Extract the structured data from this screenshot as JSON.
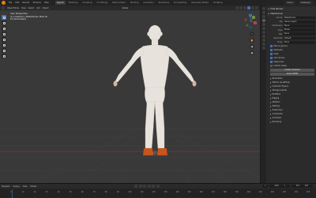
{
  "window": {
    "title": "Blender"
  },
  "topbar": {
    "menus": [
      "File",
      "Edit",
      "Render",
      "Window",
      "Help"
    ],
    "workspaces": [
      "Layout",
      "Modeling",
      "Sculpting",
      "UV Editing",
      "Texture Paint",
      "Shading",
      "Animation",
      "Rendering",
      "Compositing",
      "Geometry Nodes",
      "Scripting"
    ],
    "active_workspace": "Layout",
    "scene_label": "Scene",
    "view_layer_label": "ViewLayer"
  },
  "viewport_header": {
    "mode": "Object Mode",
    "menus": [
      "View",
      "Select",
      "Add",
      "Object"
    ],
    "transform": "Global"
  },
  "viewport_overlay": {
    "line1": "User Perspective",
    "line2": "(1) Collection | MakeHuman Male 3k",
    "line3": "10 Centimeters"
  },
  "gizmo": {
    "x_label": "X",
    "y_label": "Y",
    "z_label": "Z"
  },
  "properties": {
    "header_title": "Hide Rendex",
    "sections": {
      "main_head": "MakeHuman",
      "fields": [
        {
          "label": "Source",
          "value": "MakeHuman"
        },
        {
          "label": "Rig",
          "value": "Game engine"
        },
        {
          "label": "Subdivision",
          "value": "None"
        },
        {
          "label": "Eyes",
          "value": "Brown"
        },
        {
          "label": "Hair",
          "value": "None"
        },
        {
          "label": "Eyebrows",
          "value": "Default"
        },
        {
          "label": "Proxy",
          "value": "None"
        }
      ],
      "checks": [
        {
          "label": "Feet on ground",
          "on": true
        },
        {
          "label": "Subdivide",
          "on": true
        },
        {
          "label": "Scale",
          "on": true
        },
        {
          "label": "Add camera",
          "on": true
        },
        {
          "label": "Apply pose",
          "on": true
        },
        {
          "label": "Custom shape",
          "on": false
        }
      ],
      "buttons": [
        "Create character",
        "Import MHM"
      ],
      "sub_heads": [
        "Parameters",
        "Mesh & rig settings",
        "Character Physics"
      ],
      "collapsed": [
        "Manage presets",
        "Modifiers",
        "Rigging",
        "Skeleton",
        "Settings",
        "Shape keys",
        "Constraints",
        "Animation",
        "Rendering"
      ]
    }
  },
  "timeline": {
    "menus": [
      "Playback",
      "Keying",
      "View",
      "Marker"
    ],
    "start_label": "Start",
    "start_value": "1",
    "end_label": "End",
    "end_value": "250",
    "current_frame": "1",
    "ticks": [
      "0",
      "10",
      "20",
      "30",
      "40",
      "50",
      "60",
      "70",
      "80",
      "90",
      "100",
      "110",
      "120",
      "130",
      "140",
      "150",
      "160",
      "170",
      "180",
      "190",
      "200",
      "210",
      "220",
      "230",
      "240",
      "250"
    ]
  },
  "colors": {
    "viewport_bg": "#393939",
    "skin": "#e8e2dc",
    "shoe": "#c8541e",
    "accent": "#4772b3",
    "axis_x": "#d44a5a",
    "axis_y": "#7fa33a",
    "axis_z": "#3e7fd6"
  },
  "icons": [
    "blender-logo",
    "object-mode-icon",
    "select-icon",
    "move-icon",
    "rotate-icon",
    "scale-icon",
    "transform-icon",
    "annotate-icon",
    "measure-icon",
    "zoom-icon",
    "hand-icon",
    "camera-icon",
    "perspective-icon"
  ]
}
